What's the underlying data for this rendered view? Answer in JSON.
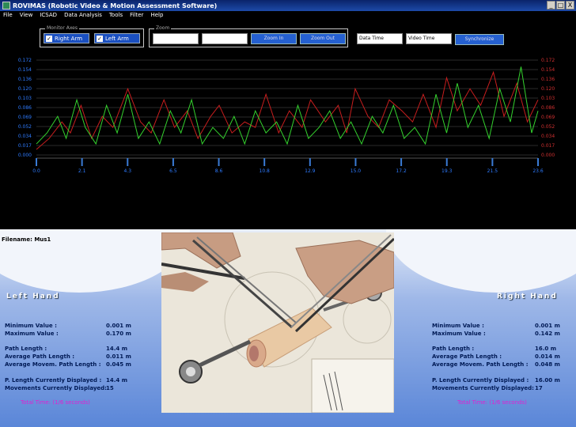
{
  "window": {
    "title": "ROVIMAS (Robotic Video & Motion Assessment Software)",
    "buttons": [
      "_",
      "□",
      "X"
    ]
  },
  "menu": [
    "File",
    "View",
    "ICSAD",
    "Data Analysis",
    "Tools",
    "Filter",
    "Help"
  ],
  "toolbar": {
    "select_axes_legend": "Monitor Axes",
    "right_arm_label": "Right Arm",
    "left_arm_label": "Left Arm",
    "zoom_legend": "Zoom",
    "zoom_in_label": "Zoom In",
    "zoom_out_label": "Zoom Out",
    "data_time_label": "Data Time",
    "video_time_label": "Video Time",
    "synchronize_label": "Synchronize"
  },
  "chart_data": {
    "type": "line",
    "y_ticks": [
      "0.172",
      "0.154",
      "0.136",
      "0.120",
      "0.103",
      "0.086",
      "0.069",
      "0.052",
      "0.034",
      "0.017",
      "0.000"
    ],
    "y_ticks_right": [
      "0.172",
      "0.154",
      "0.136",
      "0.120",
      "0.103",
      "0.086",
      "0.069",
      "0.052",
      "0.034",
      "0.017",
      "0.000"
    ],
    "x_ticks": [
      "0.0",
      "2.1",
      "4.3",
      "6.5",
      "8.6",
      "10.8",
      "12.9",
      "15.0",
      "17.2",
      "19.3",
      "21.5",
      "23.6"
    ],
    "xlim": [
      0,
      23.6
    ],
    "ylim": [
      0,
      0.172
    ],
    "grid": true,
    "series": [
      {
        "color": "#c81e1e",
        "x": [
          0.0,
          0.6,
          1.2,
          1.6,
          2.1,
          2.6,
          3.1,
          3.6,
          4.3,
          4.9,
          5.4,
          6.0,
          6.5,
          7.1,
          7.6,
          8.2,
          8.6,
          9.2,
          9.8,
          10.3,
          10.8,
          11.4,
          11.9,
          12.5,
          12.9,
          13.6,
          14.2,
          14.6,
          15.0,
          15.6,
          16.1,
          16.6,
          17.2,
          17.7,
          18.2,
          18.8,
          19.3,
          19.8,
          20.4,
          20.9,
          21.5,
          22.0,
          22.6,
          23.1,
          23.6
        ],
        "y": [
          0.01,
          0.03,
          0.06,
          0.04,
          0.09,
          0.03,
          0.07,
          0.05,
          0.12,
          0.06,
          0.04,
          0.1,
          0.05,
          0.08,
          0.03,
          0.07,
          0.09,
          0.04,
          0.06,
          0.05,
          0.11,
          0.04,
          0.08,
          0.05,
          0.1,
          0.06,
          0.09,
          0.04,
          0.12,
          0.07,
          0.05,
          0.1,
          0.08,
          0.06,
          0.11,
          0.05,
          0.14,
          0.08,
          0.12,
          0.09,
          0.15,
          0.07,
          0.13,
          0.06,
          0.1
        ]
      },
      {
        "color": "#34d22e",
        "x": [
          0.0,
          0.5,
          1.0,
          1.4,
          1.9,
          2.3,
          2.8,
          3.3,
          3.8,
          4.3,
          4.8,
          5.3,
          5.8,
          6.3,
          6.8,
          7.3,
          7.8,
          8.3,
          8.8,
          9.3,
          9.8,
          10.3,
          10.8,
          11.3,
          11.8,
          12.3,
          12.8,
          13.3,
          13.8,
          14.3,
          14.8,
          15.3,
          15.8,
          16.3,
          16.8,
          17.3,
          17.8,
          18.3,
          18.8,
          19.3,
          19.8,
          20.3,
          20.8,
          21.3,
          21.8,
          22.3,
          22.8,
          23.3,
          23.6
        ],
        "y": [
          0.02,
          0.04,
          0.07,
          0.03,
          0.1,
          0.05,
          0.02,
          0.09,
          0.04,
          0.11,
          0.03,
          0.06,
          0.02,
          0.08,
          0.04,
          0.1,
          0.02,
          0.05,
          0.03,
          0.07,
          0.02,
          0.08,
          0.04,
          0.06,
          0.02,
          0.09,
          0.03,
          0.05,
          0.08,
          0.03,
          0.06,
          0.02,
          0.07,
          0.04,
          0.09,
          0.03,
          0.05,
          0.02,
          0.11,
          0.04,
          0.13,
          0.05,
          0.09,
          0.03,
          0.12,
          0.06,
          0.16,
          0.04,
          0.08
        ]
      }
    ]
  },
  "panel": {
    "filename": "Filename: Mus1",
    "left": {
      "title": "Left Hand",
      "min_label": "Minimum  Value :",
      "min_value": "0.001 m",
      "max_label": "Maximum Value :",
      "max_value": "0.170 m",
      "path_label": "Path Length :",
      "path_value": "14.4 m",
      "avg_label": "Average Path Length :",
      "avg_value": "0.011 m",
      "avgm_label": "Average Movem. Path Length :",
      "avgm_value": "0.045 m",
      "plen_label": "P. Length Currently Displayed :",
      "plen_value": "14.4 m",
      "moves_label": "Movements Currently Displayed:",
      "moves_value": "15",
      "total": "Total Time: (1/6 seconds)"
    },
    "right": {
      "title": "Right Hand",
      "min_label": "Minimum  Value :",
      "min_value": "0.001 m",
      "max_label": "Maximum Value :",
      "max_value": "0.142 m",
      "path_label": "Path Length :",
      "path_value": "16.0 m",
      "avg_label": "Average Path Length :",
      "avg_value": "0.014 m",
      "avgm_label": "Average Movem. Path Length :",
      "avgm_value": "0.048 m",
      "plen_label": "P. Length Currently Displayed :",
      "plen_value": "16.00 m",
      "moves_label": "Movements Currently Displayed:",
      "moves_value": "17",
      "total": "Total Time: (1/6 seconds)"
    }
  }
}
